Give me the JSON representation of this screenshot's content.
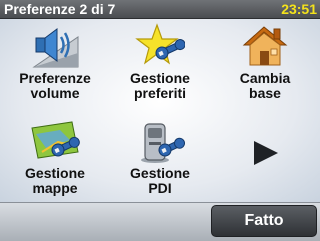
{
  "header": {
    "title": "Preferenze 2 di 7",
    "clock": "23:51"
  },
  "tiles": [
    {
      "label": "Preferenze\nvolume",
      "icon": "speaker-volume-icon"
    },
    {
      "label": "Gestione\npreferiti",
      "icon": "star-wrench-icon"
    },
    {
      "label": "Cambia\nbase",
      "icon": "house-icon"
    },
    {
      "label": "Gestione\nmappe",
      "icon": "map-wrench-icon"
    },
    {
      "label": "Gestione\nPDI",
      "icon": "poi-wrench-icon"
    }
  ],
  "nav": {
    "next_icon": "next-page-arrow-icon"
  },
  "footer": {
    "done_label": "Fatto"
  },
  "colors": {
    "clock": "#f4e21b",
    "titlebar": "#4a4d51",
    "done_button": "#3a3d41"
  }
}
